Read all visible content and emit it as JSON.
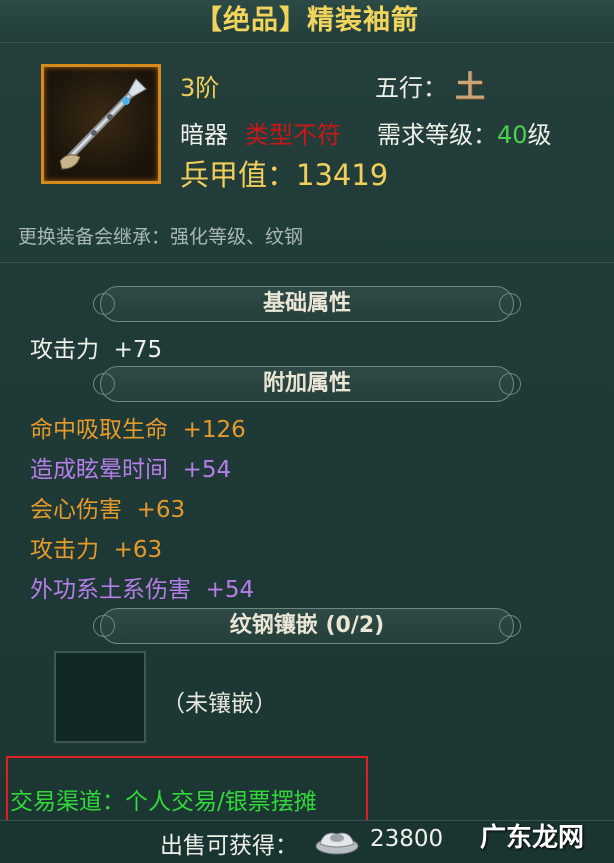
{
  "item": {
    "title": "【绝品】精装袖箭",
    "icon": "sleeve-arrow-icon",
    "tier": "3阶",
    "wuxing_label": "五行：",
    "wuxing_value": "土",
    "type_label": "暗器",
    "type_warning": "类型不符",
    "req_label": "需求等级：",
    "req_level": "40",
    "req_unit": "级",
    "bingjia": "兵甲值：13419",
    "inherit_note": "更换装备会继承：强化等级、纹钢"
  },
  "sections": {
    "basic": "基础属性",
    "extra": "附加属性",
    "socket": "纹钢镶嵌 (0/2)"
  },
  "basic_attrs": [
    {
      "text": "攻击力  +75"
    }
  ],
  "extra_attrs": [
    {
      "text": "命中吸取生命  +126"
    },
    {
      "text": "造成眩晕时间  +54"
    },
    {
      "text": "会心伤害  +63"
    },
    {
      "text": "攻击力  +63"
    },
    {
      "text": "外功系土系伤害  +54"
    }
  ],
  "socket": {
    "empty_text": "（未镶嵌）"
  },
  "trade": {
    "text": "交易渠道：个人交易/银票摆摊"
  },
  "sell": {
    "label": "出售可获得：",
    "value": "23800",
    "currency_icon": "silver-ingot-icon"
  },
  "watermark": "广东龙网",
  "colors": {
    "title": "#f1d45c",
    "warning": "#c81818",
    "level": "#4ed04e",
    "orange_attr": "#e59a2c",
    "purple_attr": "#b57ee8",
    "trade": "#32d83a",
    "highlight_box": "#e02020"
  }
}
